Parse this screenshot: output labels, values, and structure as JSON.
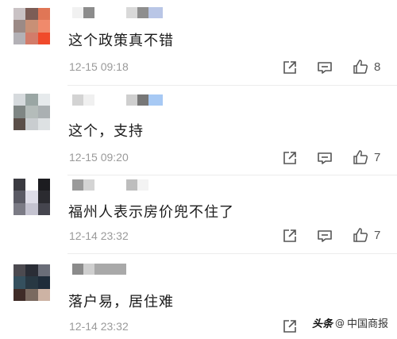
{
  "comments": [
    {
      "text": "这个政策真不错",
      "time": "12-15 09:18",
      "likes": "8",
      "avatar_colors": [
        "#c9c2c4",
        "#7c5d56",
        "#e07656",
        "#9b8a86",
        "#c89076",
        "#f08a6c",
        "#b3b1b6",
        "#d27c6a",
        "#f04a2b"
      ],
      "name_colors": [
        "#f1f1f1",
        "#8c8c8c",
        "#ffffff",
        "#d9d9d9",
        "#8e8e8e",
        "#b9c6e6"
      ]
    },
    {
      "text": "这个，支持",
      "time": "12-15 09:20",
      "likes": "7",
      "avatar_colors": [
        "#d6dadd",
        "#9aa6a4",
        "#e6eaec",
        "#7f8684",
        "#b4bcba",
        "#aab0b2",
        "#5b4f49",
        "#c9cdd0",
        "#dde1e3"
      ],
      "name_colors": [
        "#d3d3d3",
        "#f0f0f0",
        "#ffffff",
        "#cfcfcf",
        "#777777",
        "#a7c9f4"
      ]
    },
    {
      "text": "福州人表示房价兜不住了",
      "time": "12-14 23:32",
      "likes": "7",
      "avatar_colors": [
        "#3a3a40",
        "#ffffff",
        "#1c1c20",
        "#5a5a64",
        "#dedde8",
        "#2b2b30",
        "#7b7b85",
        "#c4c3d0",
        "#45454e"
      ],
      "name_colors": [
        "#9a9a9a",
        "#d4d4d4",
        "#ffffff",
        "#bdbdbd",
        "#f3f3f3",
        "#ffffff"
      ]
    },
    {
      "text": "落户易，居住难",
      "time": "12-14 23:32",
      "likes": "",
      "avatar_colors": [
        "#4c4a50",
        "#2a2d36",
        "#6a6d78",
        "#35505e",
        "#283843",
        "#1f2c3a",
        "#3f2c28",
        "#7a6a60",
        "#cdb3a4"
      ],
      "name_colors": [
        "#8b8b8b",
        "#cfcfcf",
        "#a9a9a9",
        "#ffffff",
        "#ffffff",
        "#ffffff"
      ]
    }
  ],
  "watermark": {
    "logo": "头条",
    "at": "@",
    "account": "中国商报"
  },
  "icons": [
    "share-icon",
    "comment-icon",
    "thumbs-up-icon"
  ],
  "colors": {
    "text": "#1b1b1b",
    "time": "#9a9a9a",
    "icon": "#555555"
  }
}
